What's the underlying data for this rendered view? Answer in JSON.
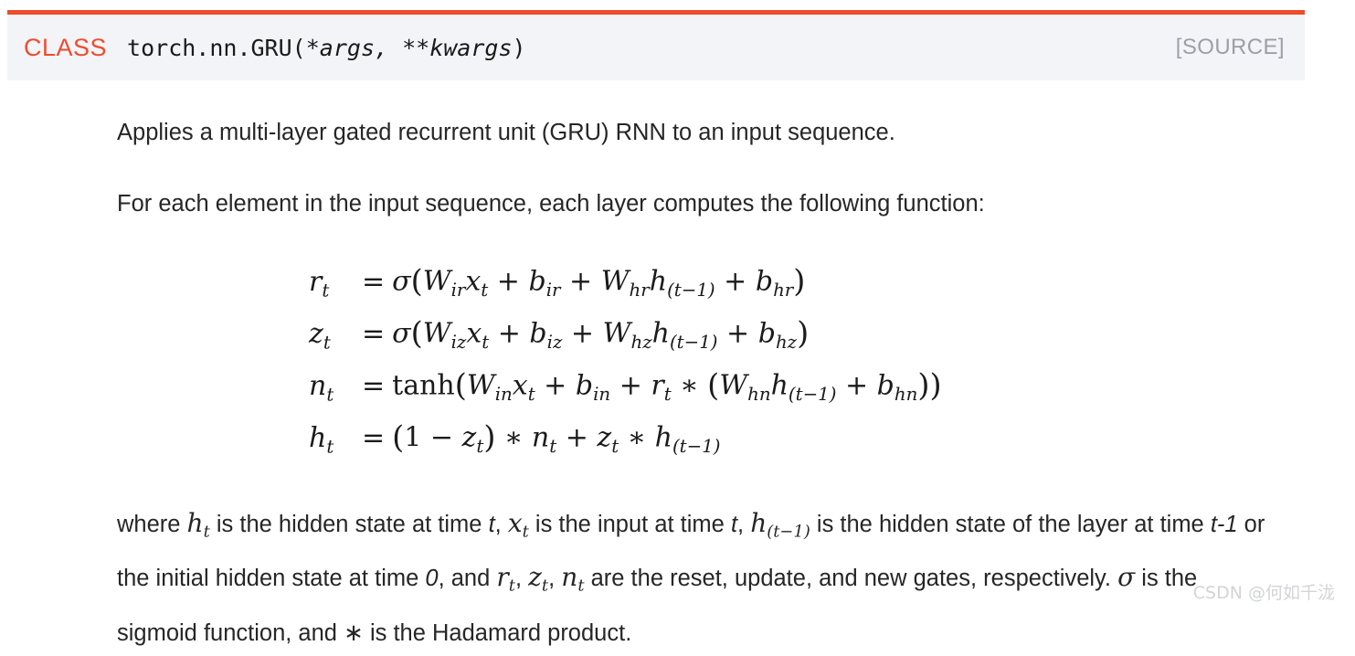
{
  "signature": {
    "keyword": "CLASS",
    "qualified_name": "torch.nn.GRU",
    "open_paren": "(",
    "args": "*args, **kwargs",
    "close_paren": ")",
    "source_link": "[SOURCE]",
    "accent_color": "#ee4c2c",
    "header_bg": "#f3f4f7"
  },
  "body": {
    "intro": "Applies a multi-layer gated recurrent unit (GRU) RNN to an input sequence.",
    "lead_in": "For each element in the input sequence, each layer computes the following function:"
  },
  "equations": [
    {
      "id": "reset-gate",
      "lhs_var": "r",
      "lhs_sub": "t",
      "relation": "=",
      "plain": "r_t = σ(W_ir x_t + b_ir + W_hr h_(t-1) + b_hr)",
      "func": "σ",
      "terms": [
        {
          "var": "W",
          "sub": "ir"
        },
        {
          "var": "x",
          "sub": "t"
        },
        {
          "var": "b",
          "sub": "ir"
        },
        {
          "var": "W",
          "sub": "hr"
        },
        {
          "var": "h",
          "sub": "(t−1)"
        },
        {
          "var": "b",
          "sub": "hr"
        }
      ]
    },
    {
      "id": "update-gate",
      "lhs_var": "z",
      "lhs_sub": "t",
      "relation": "=",
      "plain": "z_t = σ(W_iz x_t + b_iz + W_hz h_(t-1) + b_hz)",
      "func": "σ",
      "terms": [
        {
          "var": "W",
          "sub": "iz"
        },
        {
          "var": "x",
          "sub": "t"
        },
        {
          "var": "b",
          "sub": "iz"
        },
        {
          "var": "W",
          "sub": "hz"
        },
        {
          "var": "h",
          "sub": "(t−1)"
        },
        {
          "var": "b",
          "sub": "hz"
        }
      ]
    },
    {
      "id": "new-gate",
      "lhs_var": "n",
      "lhs_sub": "t",
      "relation": "=",
      "plain": "n_t = tanh(W_in x_t + b_in + r_t * (W_hn h_(t-1) + b_hn))",
      "func": "tanh",
      "terms": [
        {
          "var": "W",
          "sub": "in"
        },
        {
          "var": "x",
          "sub": "t"
        },
        {
          "var": "b",
          "sub": "in"
        },
        {
          "var": "r",
          "sub": "t"
        },
        {
          "var": "W",
          "sub": "hn"
        },
        {
          "var": "h",
          "sub": "(t−1)"
        },
        {
          "var": "b",
          "sub": "hn"
        }
      ]
    },
    {
      "id": "hidden-state",
      "lhs_var": "h",
      "lhs_sub": "t",
      "relation": "=",
      "plain": "h_t = (1 − z_t) ∗ n_t + z_t ∗ h_(t−1)",
      "func": "",
      "terms": [
        {
          "var": "z",
          "sub": "t"
        },
        {
          "var": "n",
          "sub": "t"
        },
        {
          "var": "z",
          "sub": "t"
        },
        {
          "var": "h",
          "sub": "(t−1)"
        }
      ]
    }
  ],
  "explanation": {
    "w_where": "where ",
    "sym_h_t": "h",
    "sym_h_t_sub": "t",
    "t1": " is the hidden state at time ",
    "time_t_1": "t",
    "t2": ", ",
    "sym_x_t": "x",
    "sym_x_t_sub": "t",
    "t3": " is the input at time ",
    "time_t_2": "t",
    "t4": ", ",
    "sym_h_tm1": "h",
    "sym_h_tm1_sub": "(t−1)",
    "t5": " is the hidden state of the layer at time ",
    "time_tm1": "t-1",
    "t6": " or the initial hidden state at time ",
    "time_zero": "0",
    "t7": ", and ",
    "sym_r_t": "r",
    "sym_r_t_sub": "t",
    "t8": ", ",
    "sym_z_t": "z",
    "sym_z_t_sub": "t",
    "t9": ", ",
    "sym_n_t": "n",
    "sym_n_t_sub": "t",
    "t10": " are the reset, update, and new gates, respectively. ",
    "sigma": "σ",
    "t11": " is the sigmoid function, and ",
    "asterisk": "∗",
    "t12": " is the Hadamard product."
  },
  "watermark": {
    "text": "CSDN @何如千泷"
  }
}
